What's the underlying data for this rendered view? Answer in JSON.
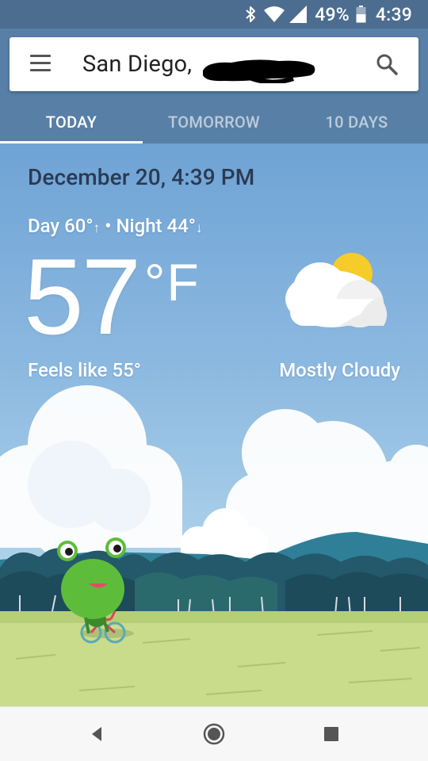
{
  "status_bar": {
    "battery_percent": "49%",
    "time": "4:39",
    "icons": [
      "bluetooth-icon",
      "wifi-icon",
      "signal-icon",
      "battery-icon"
    ]
  },
  "search_bar": {
    "location": "San Diego,",
    "icons": [
      "menu-icon",
      "search-icon"
    ]
  },
  "tabs": [
    {
      "label": "TODAY",
      "active": true
    },
    {
      "label": "TOMORROW",
      "active": false
    },
    {
      "label": "10 DAYS",
      "active": false
    }
  ],
  "weather": {
    "datetime": "December 20, 4:39 PM",
    "day_label": "Day 60°",
    "day_arrow": "↑",
    "separator": " • ",
    "night_label": "Night 44°",
    "night_arrow": "↓",
    "temperature": "57",
    "unit": "°F",
    "feels_like": "Feels like 55°",
    "condition": "Mostly Cloudy",
    "condition_icon": "partly-cloudy-icon"
  },
  "nav_bar": {
    "icons": [
      "back-icon",
      "home-icon",
      "recents-icon"
    ]
  },
  "colors": {
    "status_bar": "#4c6d8f",
    "app_bar": "#587fa6",
    "sky_top": "#6fa3d5",
    "sun": "#f5cc2a",
    "grass": "#c9dc8c",
    "frog": "#5dbd3a"
  }
}
